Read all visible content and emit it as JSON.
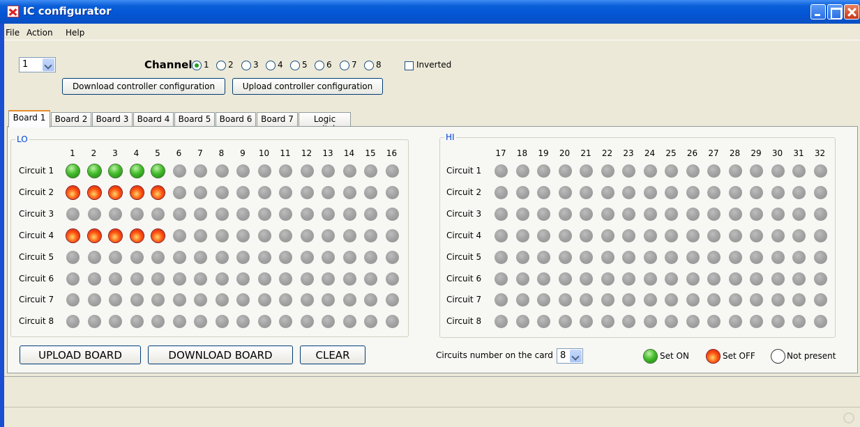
{
  "window": {
    "title": "IC configurator"
  },
  "menu": [
    "File",
    "Action",
    "Help"
  ],
  "controller_select": {
    "value": "1"
  },
  "channel": {
    "label": "Channel",
    "options": [
      "1",
      "2",
      "3",
      "4",
      "5",
      "6",
      "7",
      "8"
    ],
    "selected": "1"
  },
  "inverted": {
    "label": "Inverted",
    "checked": false
  },
  "buttons": {
    "download_config": "Download controller configuration",
    "upload_config": "Upload controller configuration",
    "upload_board": "UPLOAD BOARD",
    "download_board": "DOWNLOAD BOARD",
    "clear": "CLEAR"
  },
  "tabs": [
    "Board 1",
    "Board 2",
    "Board 3",
    "Board 4",
    "Board 5",
    "Board 6",
    "Board 7",
    "Logic switch"
  ],
  "active_tab": "Board 1",
  "lo": {
    "title": "LO",
    "columns": [
      "1",
      "2",
      "3",
      "4",
      "5",
      "6",
      "7",
      "8",
      "9",
      "10",
      "11",
      "12",
      "13",
      "14",
      "15",
      "16"
    ],
    "rows": [
      {
        "label": "Circuit 1",
        "states": [
          "on",
          "on",
          "on",
          "on",
          "on",
          "none",
          "none",
          "none",
          "none",
          "none",
          "none",
          "none",
          "none",
          "none",
          "none",
          "none"
        ]
      },
      {
        "label": "Circuit 2",
        "states": [
          "off",
          "off",
          "off",
          "off",
          "off",
          "none",
          "none",
          "none",
          "none",
          "none",
          "none",
          "none",
          "none",
          "none",
          "none",
          "none"
        ]
      },
      {
        "label": "Circuit 3",
        "states": [
          "none",
          "none",
          "none",
          "none",
          "none",
          "none",
          "none",
          "none",
          "none",
          "none",
          "none",
          "none",
          "none",
          "none",
          "none",
          "none"
        ]
      },
      {
        "label": "Circuit 4",
        "states": [
          "off",
          "off",
          "off",
          "off",
          "off",
          "none",
          "none",
          "none",
          "none",
          "none",
          "none",
          "none",
          "none",
          "none",
          "none",
          "none"
        ]
      },
      {
        "label": "Circuit 5",
        "states": [
          "none",
          "none",
          "none",
          "none",
          "none",
          "none",
          "none",
          "none",
          "none",
          "none",
          "none",
          "none",
          "none",
          "none",
          "none",
          "none"
        ]
      },
      {
        "label": "Circuit 6",
        "states": [
          "none",
          "none",
          "none",
          "none",
          "none",
          "none",
          "none",
          "none",
          "none",
          "none",
          "none",
          "none",
          "none",
          "none",
          "none",
          "none"
        ]
      },
      {
        "label": "Circuit 7",
        "states": [
          "none",
          "none",
          "none",
          "none",
          "none",
          "none",
          "none",
          "none",
          "none",
          "none",
          "none",
          "none",
          "none",
          "none",
          "none",
          "none"
        ]
      },
      {
        "label": "Circuit 8",
        "states": [
          "none",
          "none",
          "none",
          "none",
          "none",
          "none",
          "none",
          "none",
          "none",
          "none",
          "none",
          "none",
          "none",
          "none",
          "none",
          "none"
        ]
      }
    ]
  },
  "hi": {
    "title": "HI",
    "columns": [
      "17",
      "18",
      "19",
      "20",
      "21",
      "22",
      "23",
      "24",
      "25",
      "26",
      "27",
      "28",
      "29",
      "30",
      "31",
      "32"
    ],
    "rows": [
      {
        "label": "Circuit 1",
        "states": [
          "none",
          "none",
          "none",
          "none",
          "none",
          "none",
          "none",
          "none",
          "none",
          "none",
          "none",
          "none",
          "none",
          "none",
          "none",
          "none"
        ]
      },
      {
        "label": "Circuit 2",
        "states": [
          "none",
          "none",
          "none",
          "none",
          "none",
          "none",
          "none",
          "none",
          "none",
          "none",
          "none",
          "none",
          "none",
          "none",
          "none",
          "none"
        ]
      },
      {
        "label": "Circuit 3",
        "states": [
          "none",
          "none",
          "none",
          "none",
          "none",
          "none",
          "none",
          "none",
          "none",
          "none",
          "none",
          "none",
          "none",
          "none",
          "none",
          "none"
        ]
      },
      {
        "label": "Circuit 4",
        "states": [
          "none",
          "none",
          "none",
          "none",
          "none",
          "none",
          "none",
          "none",
          "none",
          "none",
          "none",
          "none",
          "none",
          "none",
          "none",
          "none"
        ]
      },
      {
        "label": "Circuit 5",
        "states": [
          "none",
          "none",
          "none",
          "none",
          "none",
          "none",
          "none",
          "none",
          "none",
          "none",
          "none",
          "none",
          "none",
          "none",
          "none",
          "none"
        ]
      },
      {
        "label": "Circuit 6",
        "states": [
          "none",
          "none",
          "none",
          "none",
          "none",
          "none",
          "none",
          "none",
          "none",
          "none",
          "none",
          "none",
          "none",
          "none",
          "none",
          "none"
        ]
      },
      {
        "label": "Circuit 7",
        "states": [
          "none",
          "none",
          "none",
          "none",
          "none",
          "none",
          "none",
          "none",
          "none",
          "none",
          "none",
          "none",
          "none",
          "none",
          "none",
          "none"
        ]
      },
      {
        "label": "Circuit 8",
        "states": [
          "none",
          "none",
          "none",
          "none",
          "none",
          "none",
          "none",
          "none",
          "none",
          "none",
          "none",
          "none",
          "none",
          "none",
          "none",
          "none"
        ]
      }
    ]
  },
  "circuits_number": {
    "label": "Circuits number on the card",
    "value": "8"
  },
  "legend": {
    "set_on": "Set ON",
    "set_off": "Set OFF",
    "not_present": "Not present"
  }
}
